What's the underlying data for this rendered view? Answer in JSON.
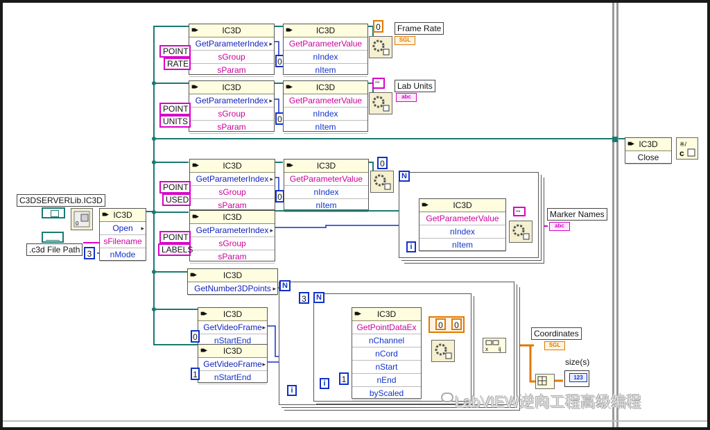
{
  "diagram": {
    "lib_label": "C3DSERVERLib.IC3D",
    "file_path_label": ".c3d File Path",
    "open_node": {
      "class": "IC3D",
      "method": "Open",
      "params": [
        "sFilename",
        "nMode"
      ]
    },
    "nmode_const": "3",
    "frame_rate": {
      "index_node": {
        "class": "IC3D",
        "method": "GetParameterIndex",
        "params": [
          "sGroup",
          "sParam"
        ]
      },
      "value_node": {
        "class": "IC3D",
        "method": "GetParameterValue",
        "params": [
          "nIndex",
          "nItem"
        ]
      },
      "group_const": "POINT",
      "param_const": "RATE",
      "item_const": "0",
      "type_const": "0",
      "indicator_label": "Frame Rate",
      "indicator_type": "SGL"
    },
    "lab_units": {
      "index_node": {
        "class": "IC3D",
        "method": "GetParameterIndex",
        "params": [
          "sGroup",
          "sParam"
        ]
      },
      "value_node": {
        "class": "IC3D",
        "method": "GetParameterValue",
        "params": [
          "nIndex",
          "nItem"
        ]
      },
      "group_const": "POINT",
      "param_const": "UNITS",
      "item_const": "0",
      "type_const": "\"\"",
      "indicator_label": "Lab Units",
      "indicator_type": "abc"
    },
    "used": {
      "index_node": {
        "class": "IC3D",
        "method": "GetParameterIndex",
        "params": [
          "sGroup",
          "sParam"
        ]
      },
      "value_node": {
        "class": "IC3D",
        "method": "GetParameterValue",
        "params": [
          "nIndex",
          "nItem"
        ]
      },
      "group_const": "POINT",
      "param_const": "USED",
      "item_const": "0",
      "type_const": "0"
    },
    "labels": {
      "index_node": {
        "class": "IC3D",
        "method": "GetParameterIndex",
        "params": [
          "sGroup",
          "sParam"
        ]
      },
      "loop_value_node": {
        "class": "IC3D",
        "method": "GetParameterValue",
        "params": [
          "nIndex",
          "nItem"
        ]
      },
      "group_const": "POINT",
      "param_const": "LABELS",
      "type_const": "\"\"",
      "indicator_label": "Marker Names",
      "indicator_type": "abc",
      "loop_n": "N",
      "loop_i": "i"
    },
    "close_node": {
      "class": "IC3D",
      "method": "Close"
    },
    "points_node": {
      "class": "IC3D",
      "method": "GetNumber3DPoints"
    },
    "video_start_node": {
      "class": "IC3D",
      "method": "GetVideoFrame",
      "param": "nStartEnd",
      "const": "0"
    },
    "video_end_node": {
      "class": "IC3D",
      "method": "GetVideoFrame",
      "param": "nStartEnd",
      "const": "1"
    },
    "point_data_node": {
      "class": "IC3D",
      "method": "GetPointDataEx",
      "params": [
        "nChannel",
        "nCord",
        "nStart",
        "nEnd",
        "byScaled"
      ]
    },
    "outer_loop_n": "N",
    "inner_loop_count": "3",
    "inner_loop_n": "N",
    "outer_loop_i": "i",
    "inner_loop_i": "i",
    "scaled_const": "1",
    "type_cluster": [
      "0",
      "0"
    ],
    "coordinates_label": "Coordinates",
    "coordinates_type": "SGL",
    "size_label": "size(s)",
    "size_type": "123",
    "watermark": "LabVIEW逆向工程高级编程",
    "colors": {
      "numeric_wire": "#1030c8",
      "string_wire": "#d800c8",
      "refnum_wire": "#1a7a70",
      "float_wire": "#e07800"
    }
  }
}
